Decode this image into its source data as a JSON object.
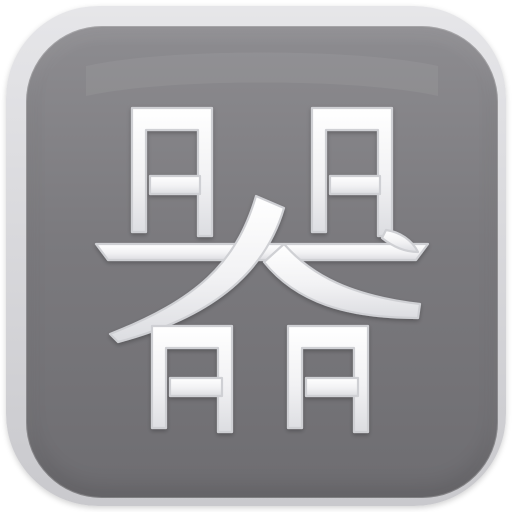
{
  "app_icon": {
    "icon": "ideograph-vessel-icon",
    "character": "器",
    "colors": {
      "outer_frame": "#d6d6da",
      "face_top": "#8d8c90",
      "face_bottom": "#6e6d71",
      "glyph_fill": "#f3f3f5",
      "glyph_edge": "#cfd0d4"
    }
  }
}
